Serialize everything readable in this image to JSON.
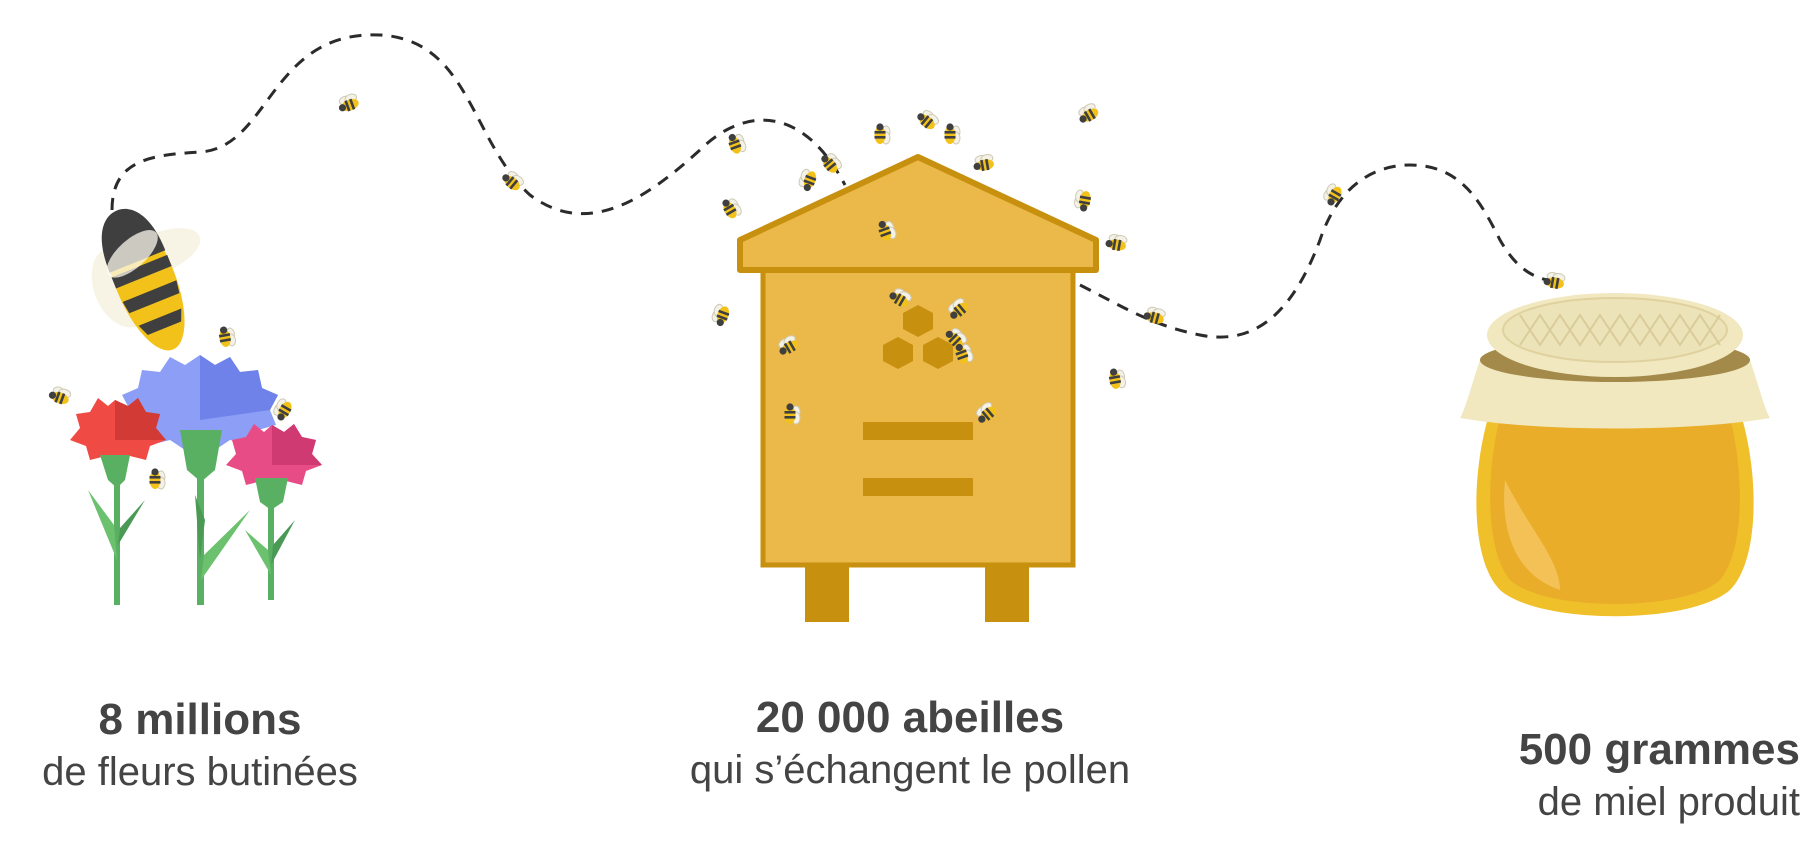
{
  "stats": [
    {
      "value_label": "8 millions",
      "description": "de fleurs butinées"
    },
    {
      "value_label": "20 000 abeilles",
      "description": "qui s’échangent le pollen"
    },
    {
      "value_label": "500 grammes",
      "description": "de miel produit"
    }
  ],
  "colors": {
    "text": "#444444",
    "hive": "#ebb84a",
    "hive_outline": "#c8900f",
    "honey": "#f0b52d",
    "jar_cloth": "#f1e8c0",
    "bee_yellow": "#f2c21b",
    "bee_dark": "#3f3f3f",
    "flower_blue": "#8c9ef5",
    "flower_red": "#ef4a43",
    "flower_pink": "#e84c86",
    "stem_green": "#5ab062"
  },
  "icons": [
    "bee-icon",
    "flower-bouquet-icon",
    "beehive-icon",
    "honey-jar-icon",
    "flight-path"
  ]
}
